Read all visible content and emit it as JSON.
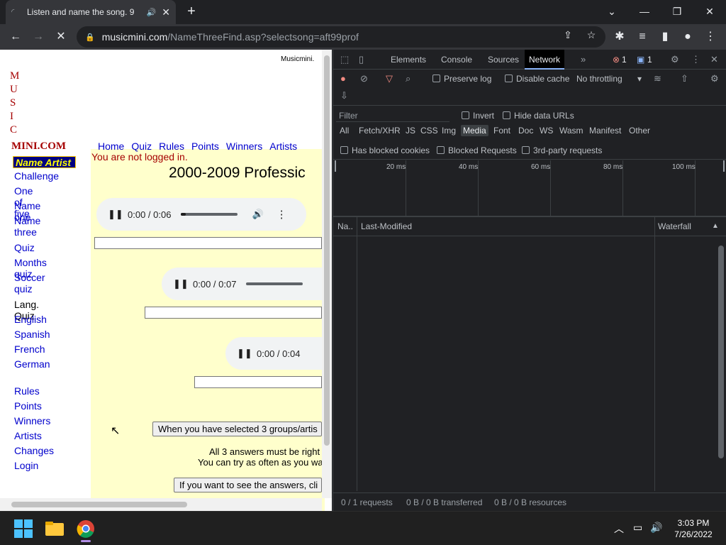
{
  "browser": {
    "tab_title": "Listen and name the song. 9",
    "url_host": "musicmini.com",
    "url_path": "/NameThreeFind.asp?selectsong=aft99prof"
  },
  "page": {
    "logo_letters": [
      "M",
      "U",
      "S",
      "I",
      "C"
    ],
    "logo_domain": "MINI.COM",
    "top_right_text": "Musicmini.",
    "name_artist_badge": "Name Artist",
    "sidebar_group1": [
      "Challenge",
      "One of five",
      "Name one",
      "Name three"
    ],
    "sidebar_group2": [
      "Quiz",
      "Months quiz",
      "Soccer quiz"
    ],
    "lang_quiz_heading": "Lang. Quiz",
    "sidebar_group3": [
      "English",
      "Spanish",
      "French",
      "German"
    ],
    "sidebar_group4": [
      "Rules",
      "Points",
      "Winners",
      "Artists",
      "Changes",
      "Login"
    ],
    "top_nav": [
      "Home",
      "Quiz",
      "Rules",
      "Points",
      "Winners",
      "Artists"
    ],
    "not_logged_in": "You are not logged in.",
    "heading": "2000-2009 Professic",
    "players": [
      {
        "time": "0:00 / 0:06",
        "progress": 0.08
      },
      {
        "time": "0:00 / 0:07",
        "progress": 0.0
      },
      {
        "time": "0:00 / 0:04",
        "progress": 0.0
      }
    ],
    "submit_button": "When you have selected 3 groups/artis",
    "rule_line1": "All 3 answers must be right",
    "rule_line2": "You can try as often as you wa",
    "answers_button": "If you want to see the answers, cli"
  },
  "devtools": {
    "tabs": [
      "Elements",
      "Console",
      "Sources",
      "Network"
    ],
    "active_tab": "Network",
    "error_count": "1",
    "message_count": "1",
    "preserve_log": "Preserve log",
    "disable_cache": "Disable cache",
    "throttling": "No throttling",
    "filter_placeholder": "Filter",
    "invert": "Invert",
    "hide_data_urls": "Hide data URLs",
    "filter_types": [
      "All",
      "Fetch/XHR",
      "JS",
      "CSS",
      "Img",
      "Media",
      "Font",
      "Doc",
      "WS",
      "Wasm",
      "Manifest",
      "Other"
    ],
    "active_filter": "Media",
    "has_blocked_cookies": "Has blocked cookies",
    "blocked_requests": "Blocked Requests",
    "third_party": "3rd-party requests",
    "ticks": [
      "20 ms",
      "40 ms",
      "60 ms",
      "80 ms",
      "100 ms"
    ],
    "col_name": "Na..",
    "col_last_modified": "Last-Modified",
    "col_waterfall": "Waterfall",
    "status_requests": "0 / 1 requests",
    "status_transferred": "0 B / 0 B transferred",
    "status_resources": "0 B / 0 B resources"
  },
  "taskbar": {
    "time": "3:03 PM",
    "date": "7/26/2022"
  }
}
